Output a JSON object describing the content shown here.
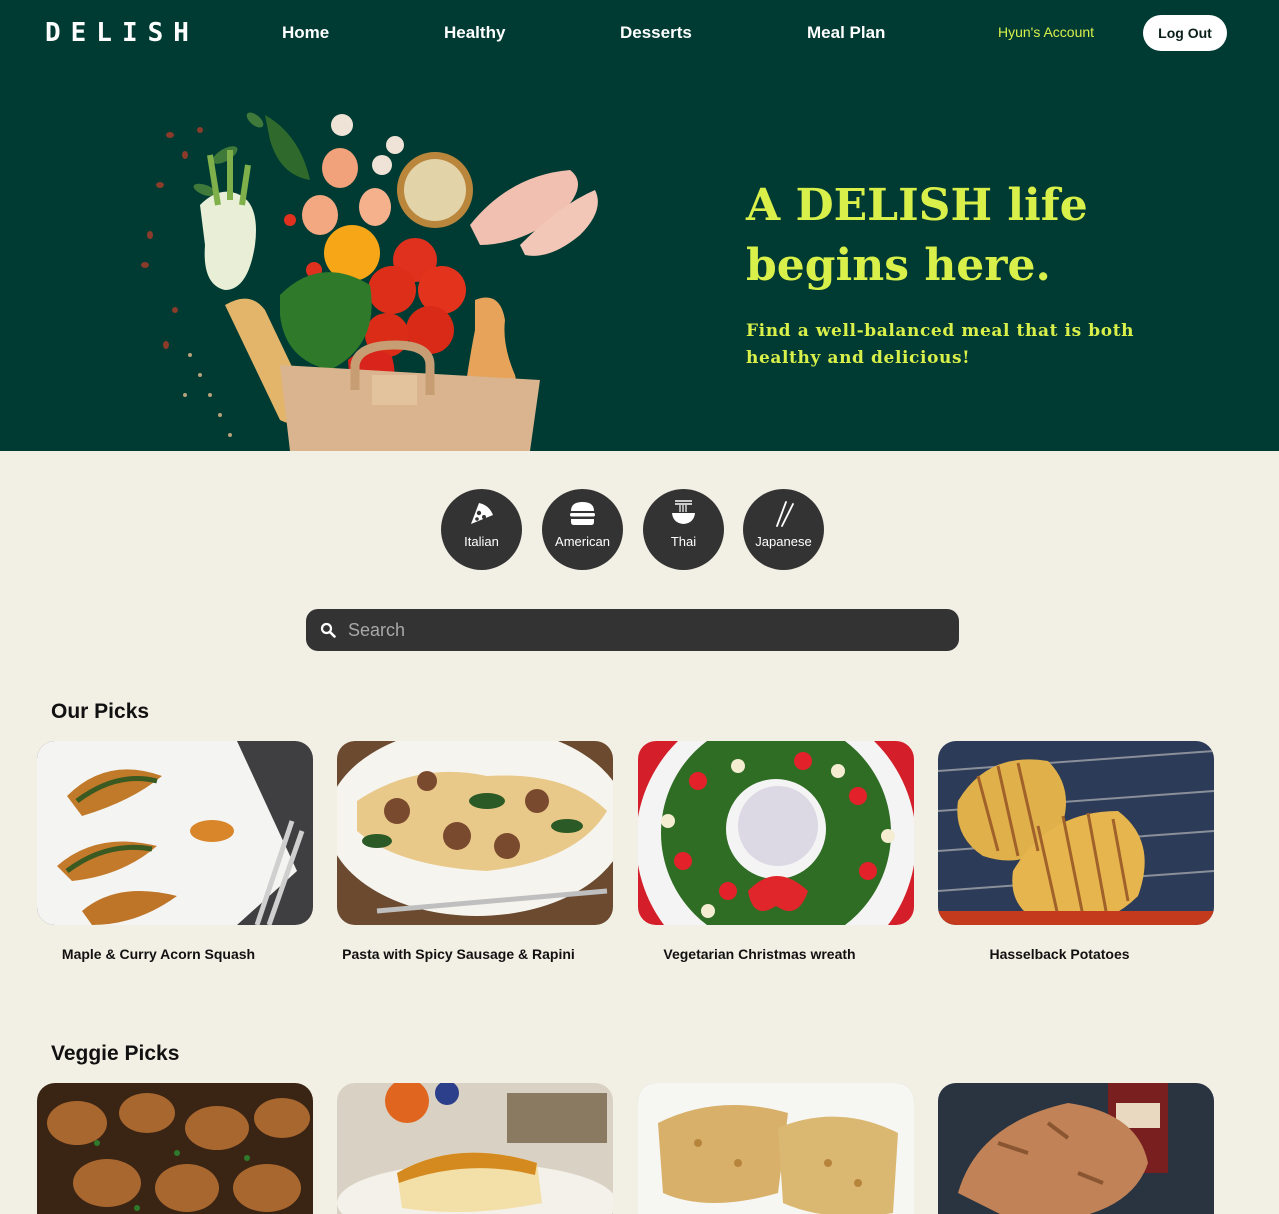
{
  "header": {
    "logo": "DELISH",
    "nav": [
      "Home",
      "Healthy",
      "Desserts",
      "Meal Plan"
    ],
    "account": "Hyun's Account",
    "logout": "Log Out"
  },
  "hero": {
    "title": "A DELISH life begins here.",
    "subtitle": "Find a well-balanced meal that is both healthy and delicious!"
  },
  "cuisines": [
    {
      "label": "Italian",
      "icon": "pizza-icon"
    },
    {
      "label": "American",
      "icon": "burger-icon"
    },
    {
      "label": "Thai",
      "icon": "noodle-bowl-icon"
    },
    {
      "label": "Japanese",
      "icon": "chopsticks-icon"
    }
  ],
  "search": {
    "placeholder": "Search",
    "value": ""
  },
  "our_picks": {
    "title": "Our Picks",
    "items": [
      "Maple & Curry Acorn Squash",
      "Pasta with Spicy Sausage & Rapini",
      "Vegetarian Christmas wreath",
      "Hasselback Potatoes"
    ]
  },
  "veggie_picks": {
    "title": "Veggie Picks"
  },
  "colors": {
    "hero_bg": "#003b33",
    "accent": "#d9f04a",
    "page_bg": "#f2efe4",
    "dark": "#333333"
  }
}
